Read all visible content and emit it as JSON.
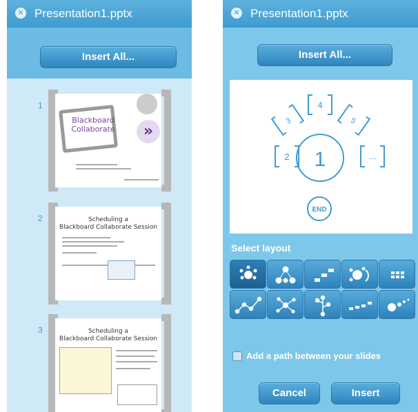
{
  "left_panel": {
    "title": "Presentation1.pptx",
    "insert_all_label": "Insert All...",
    "slides": [
      {
        "number": "1",
        "title_line1": "Blackboard",
        "title_line2": "Collaborate"
      },
      {
        "number": "2",
        "title_line1": "Scheduling a",
        "title_line2": "Blackboard Collaborate Session"
      },
      {
        "number": "3",
        "title_line1": "Scheduling a",
        "title_line2": "Blackboard Collaborate Session"
      }
    ]
  },
  "right_panel": {
    "title": "Presentation1.pptx",
    "insert_all_label": "Insert All...",
    "layout_preview": {
      "center": "1",
      "nodes": [
        "2",
        "3",
        "4",
        "5",
        "..."
      ],
      "end_label": "END"
    },
    "select_layout_label": "Select layout",
    "layouts": [
      "circle",
      "tree",
      "stairs",
      "orbit",
      "grid",
      "path",
      "network",
      "branch",
      "flow",
      "spiral"
    ],
    "path_checkbox_label": "Add a path between your slides",
    "path_checked": false,
    "cancel_label": "Cancel",
    "insert_label": "Insert"
  },
  "colors": {
    "accent": "#3f9bd0",
    "button": "#2f86be"
  }
}
